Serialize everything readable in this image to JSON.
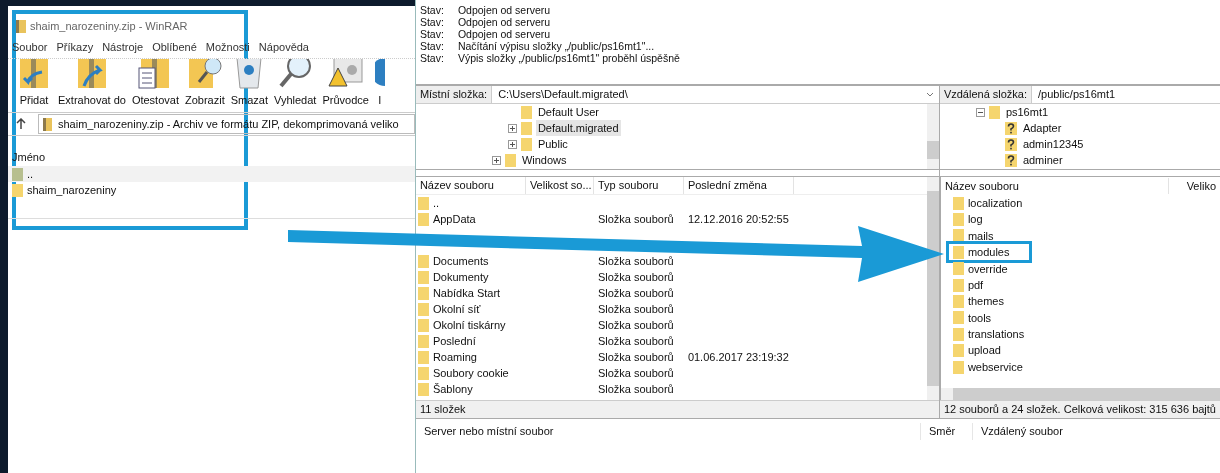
{
  "winrar": {
    "title": "shaim_narozeniny.zip - WinRAR",
    "menu": [
      "Soubor",
      "Příkazy",
      "Nástroje",
      "Oblíbené",
      "Možnosti",
      "Nápověda"
    ],
    "toolbar": [
      {
        "label": "Přidat",
        "kind": "add"
      },
      {
        "label": "Extrahovat do",
        "kind": "extract"
      },
      {
        "label": "Otestovat",
        "kind": "test"
      },
      {
        "label": "Zobrazit",
        "kind": "view"
      },
      {
        "label": "Smazat",
        "kind": "delete"
      },
      {
        "label": "Vyhledat",
        "kind": "find"
      },
      {
        "label": "Průvodce",
        "kind": "wizard"
      },
      {
        "label": "I",
        "kind": "info"
      }
    ],
    "address": "shaim_narozeniny.zip - Archiv ve formátu ZIP, dekomprimovaná veliko",
    "column": "Jméno",
    "rows": [
      {
        "name": "..",
        "kind": "up"
      },
      {
        "name": "shaim_narozeniny",
        "kind": "folder"
      }
    ]
  },
  "filezilla": {
    "log": [
      {
        "label": "Stav:",
        "message": "Odpojen od serveru"
      },
      {
        "label": "Stav:",
        "message": "Odpojen od serveru"
      },
      {
        "label": "Stav:",
        "message": "Odpojen od serveru"
      },
      {
        "label": "Stav:",
        "message": "Načítání výpisu složky „/public/ps16mt1\"..."
      },
      {
        "label": "Stav:",
        "message": "Výpis složky „/public/ps16mt1\" proběhl úspěšně"
      }
    ],
    "local": {
      "label": "Místní složka:",
      "path": "C:\\Users\\Default.migrated\\",
      "tree": [
        {
          "children": [
            {
              "name": "Default User",
              "kind": "folder",
              "expandable": false,
              "selected": false
            },
            {
              "name": "Default.migrated",
              "kind": "folder",
              "expandable": true,
              "selected": true
            },
            {
              "name": "Public",
              "kind": "folder",
              "expandable": true,
              "selected": false
            }
          ]
        },
        {
          "name": "Windows",
          "kind": "folder",
          "expandable": true,
          "selected": false
        }
      ],
      "columns": [
        "Název souboru",
        "Velikost so...",
        "Typ souboru",
        "Poslední změna"
      ],
      "rows": [
        {
          "name": "..",
          "kind": "folder"
        },
        {
          "name": "AppData",
          "type": "Složka souborů",
          "modified": "12.12.2016 20:52:55",
          "kind": "folder"
        },
        {
          "kind": "covered"
        },
        {
          "name": "Documents",
          "type": "Složka souborů",
          "kind": "folder"
        },
        {
          "name": "Dokumenty",
          "type": "Složka souborů",
          "kind": "folder"
        },
        {
          "name": "Nabídka Start",
          "type": "Složka souborů",
          "kind": "folder"
        },
        {
          "name": "Okolní síť",
          "type": "Složka souborů",
          "kind": "folder"
        },
        {
          "name": "Okolní tiskárny",
          "type": "Složka souborů",
          "kind": "folder"
        },
        {
          "name": "Poslední",
          "type": "Složka souborů",
          "kind": "folder"
        },
        {
          "name": "Roaming",
          "type": "Složka souborů",
          "modified": "01.06.2017 23:19:32",
          "kind": "folder"
        },
        {
          "name": "Soubory cookie",
          "type": "Složka souborů",
          "kind": "folder"
        },
        {
          "name": "Šablony",
          "type": "Složka souborů",
          "kind": "folder"
        }
      ],
      "status": "11 složek"
    },
    "remote": {
      "label": "Vzdálená složka:",
      "path": "/public/ps16mt1",
      "tree": [
        {
          "name": "ps16mt1",
          "kind": "folder",
          "expandable": true,
          "selected": false,
          "children": [
            {
              "name": "Adapter",
              "kind": "unknown",
              "expandable": false,
              "selected": false
            },
            {
              "name": "admin12345",
              "kind": "unknown",
              "expandable": false,
              "selected": false
            },
            {
              "name": "adminer",
              "kind": "unknown",
              "expandable": false,
              "selected": false
            }
          ]
        }
      ],
      "columns": [
        "Název souboru",
        "Veliko"
      ],
      "rows": [
        {
          "name": "localization",
          "highlighted": false
        },
        {
          "name": "log",
          "highlighted": false
        },
        {
          "name": "mails",
          "highlighted": false
        },
        {
          "name": "modules",
          "highlighted": true
        },
        {
          "name": "override",
          "highlighted": false
        },
        {
          "name": "pdf",
          "highlighted": false
        },
        {
          "name": "themes",
          "highlighted": false
        },
        {
          "name": "tools",
          "highlighted": false
        },
        {
          "name": "translations",
          "highlighted": false
        },
        {
          "name": "upload",
          "highlighted": false
        },
        {
          "name": "webservice",
          "highlighted": false
        }
      ],
      "status": "12 souborů a 24 složek. Celková velikost: 315 636 bajtů"
    },
    "queue": {
      "columns": [
        "Server nebo místní soubor",
        "Směr",
        "Vzdálený soubor"
      ]
    }
  }
}
